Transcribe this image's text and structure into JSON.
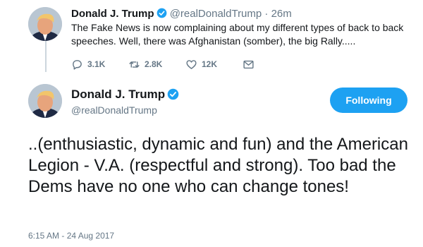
{
  "parent_tweet": {
    "name": "Donald J. Trump",
    "handle": "@realDonaldTrump",
    "separator": "·",
    "time": "26m",
    "text": "The Fake News is now complaining about my different types of back to back speeches. Well, there was Afghanistan (somber), the big Rally.....",
    "actions": {
      "replies": "3.1K",
      "retweets": "2.8K",
      "likes": "12K"
    }
  },
  "main_tweet": {
    "name": "Donald J. Trump",
    "handle": "@realDonaldTrump",
    "follow_label": "Following",
    "text": "..(enthusiastic, dynamic and fun) and the American Legion - V.A. (respectful and strong). Too bad the Dems have no one who can change tones!",
    "timestamp": "6:15 AM - 24 Aug 2017"
  },
  "icons": {
    "verified": "verified-badge-icon",
    "reply": "reply-icon",
    "retweet": "retweet-icon",
    "like": "heart-icon",
    "message": "envelope-icon"
  },
  "colors": {
    "accent": "#1da1f2",
    "text": "#14171a",
    "muted": "#657786",
    "thread_line": "#ccd6dd"
  }
}
